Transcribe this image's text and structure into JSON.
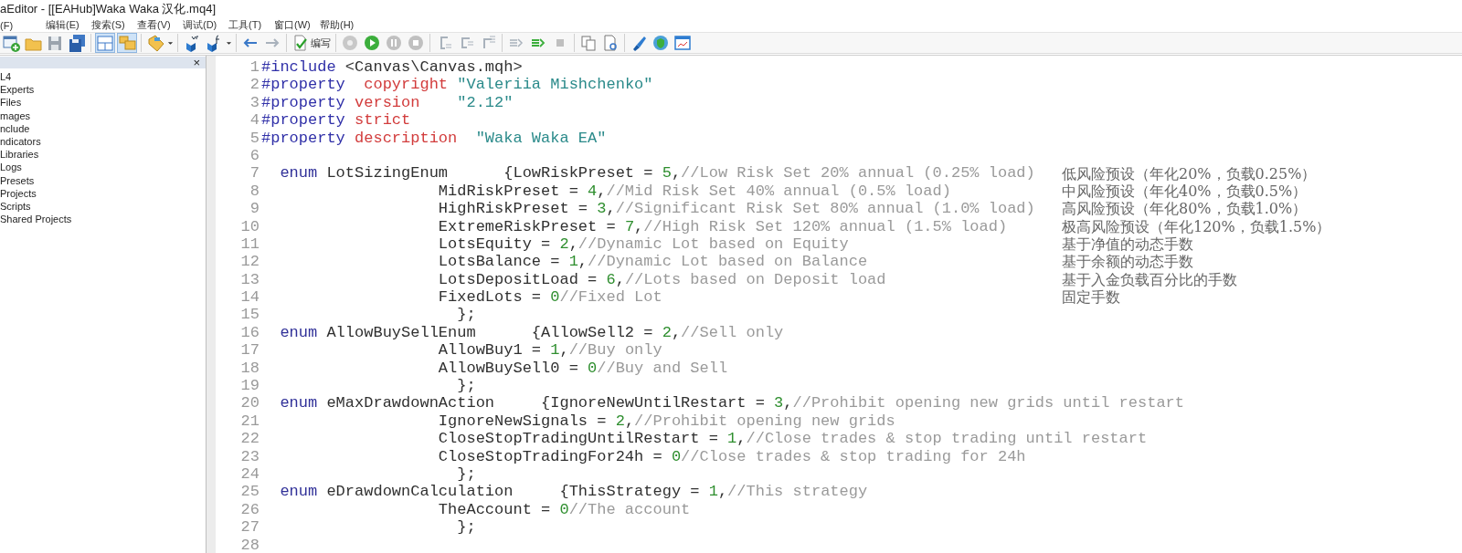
{
  "window": {
    "title": "aEditor - [[EAHub]Waka Waka 汉化.mq4]"
  },
  "menu": [
    "(F)",
    "编辑(E)",
    "搜索(S)",
    "查看(V)",
    "调试(D)",
    "工具(T)",
    "窗口(W)",
    "帮助(H)"
  ],
  "toolbar": {
    "compile_label": "编写"
  },
  "navigator": {
    "close": "×",
    "items": [
      "L4",
      "Experts",
      "Files",
      "mages",
      "nclude",
      "ndicators",
      "Libraries",
      "Logs",
      "Presets",
      "Projects",
      "Scripts",
      "Shared Projects"
    ]
  },
  "editor": {
    "lines": [
      {
        "number": "1",
        "tokens": [
          {
            "kind": "preprocessor",
            "text": "#include"
          },
          {
            "kind": "plain",
            "text": " <Canvas\\Canvas.mqh>"
          }
        ]
      },
      {
        "number": "2",
        "tokens": [
          {
            "kind": "preprocessor",
            "text": "#property"
          },
          {
            "kind": "property",
            "text": "  copyright"
          },
          {
            "kind": "string",
            "text": " \"Valeriia Mishchenko\""
          }
        ]
      },
      {
        "number": "3",
        "tokens": [
          {
            "kind": "preprocessor",
            "text": "#property"
          },
          {
            "kind": "property",
            "text": " version"
          },
          {
            "kind": "string",
            "text": "    \"2.12\""
          }
        ]
      },
      {
        "number": "4",
        "tokens": [
          {
            "kind": "preprocessor",
            "text": "#property"
          },
          {
            "kind": "property",
            "text": " strict"
          }
        ]
      },
      {
        "number": "5",
        "tokens": [
          {
            "kind": "preprocessor",
            "text": "#property"
          },
          {
            "kind": "property",
            "text": " description"
          },
          {
            "kind": "string",
            "text": "  \"Waka Waka EA\""
          }
        ]
      },
      {
        "number": "6"
      },
      {
        "number": "7",
        "tokens": [
          {
            "kind": "keyword",
            "text": "  enum"
          },
          {
            "kind": "plain",
            "text": " LotSizingEnum      {LowRiskPreset = "
          },
          {
            "kind": "number",
            "text": "5"
          },
          {
            "kind": "plain",
            "text": ","
          },
          {
            "kind": "comment",
            "text": "//Low Risk Set 20% annual (0.25% load)"
          }
        ],
        "note": "低风险预设（年化20%，负载0.25%）"
      },
      {
        "number": "8",
        "tokens": [
          {
            "kind": "plain",
            "text": "                   MidRiskPreset = "
          },
          {
            "kind": "number",
            "text": "4"
          },
          {
            "kind": "plain",
            "text": ","
          },
          {
            "kind": "comment",
            "text": "//Mid Risk Set 40% annual (0.5% load)"
          }
        ],
        "note": "中风险预设（年化40%，负载0.5%）"
      },
      {
        "number": "9",
        "tokens": [
          {
            "kind": "plain",
            "text": "                   HighRiskPreset = "
          },
          {
            "kind": "number",
            "text": "3"
          },
          {
            "kind": "plain",
            "text": ","
          },
          {
            "kind": "comment",
            "text": "//Significant Risk Set 80% annual (1.0% load)"
          }
        ],
        "note": "高风险预设（年化80%，负载1.0%）"
      },
      {
        "number": "10",
        "tokens": [
          {
            "kind": "plain",
            "text": "                   ExtremeRiskPreset = "
          },
          {
            "kind": "number",
            "text": "7"
          },
          {
            "kind": "plain",
            "text": ","
          },
          {
            "kind": "comment",
            "text": "//High Risk Set 120% annual (1.5% load)"
          }
        ],
        "note": "极高风险预设（年化120%，负载1.5%）"
      },
      {
        "number": "11",
        "tokens": [
          {
            "kind": "plain",
            "text": "                   LotsEquity = "
          },
          {
            "kind": "number",
            "text": "2"
          },
          {
            "kind": "plain",
            "text": ","
          },
          {
            "kind": "comment",
            "text": "//Dynamic Lot based on Equity"
          }
        ],
        "note": "基于净值的动态手数"
      },
      {
        "number": "12",
        "tokens": [
          {
            "kind": "plain",
            "text": "                   LotsBalance = "
          },
          {
            "kind": "number",
            "text": "1"
          },
          {
            "kind": "plain",
            "text": ","
          },
          {
            "kind": "comment",
            "text": "//Dynamic Lot based on Balance"
          }
        ],
        "note": "基于余额的动态手数"
      },
      {
        "number": "13",
        "tokens": [
          {
            "kind": "plain",
            "text": "                   LotsDepositLoad = "
          },
          {
            "kind": "number",
            "text": "6"
          },
          {
            "kind": "plain",
            "text": ","
          },
          {
            "kind": "comment",
            "text": "//Lots based on Deposit load"
          }
        ],
        "note": "基于入金负载百分比的手数"
      },
      {
        "number": "14",
        "tokens": [
          {
            "kind": "plain",
            "text": "                   FixedLots = "
          },
          {
            "kind": "number",
            "text": "0"
          },
          {
            "kind": "comment",
            "text": "//Fixed Lot"
          }
        ],
        "note": "固定手数"
      },
      {
        "number": "15",
        "tokens": [
          {
            "kind": "plain",
            "text": "                     };"
          }
        ]
      },
      {
        "number": "16",
        "tokens": [
          {
            "kind": "keyword",
            "text": "  enum"
          },
          {
            "kind": "plain",
            "text": " AllowBuySellEnum      {AllowSell2 = "
          },
          {
            "kind": "number",
            "text": "2"
          },
          {
            "kind": "plain",
            "text": ","
          },
          {
            "kind": "comment",
            "text": "//Sell only"
          }
        ]
      },
      {
        "number": "17",
        "tokens": [
          {
            "kind": "plain",
            "text": "                   AllowBuy1 = "
          },
          {
            "kind": "number",
            "text": "1"
          },
          {
            "kind": "plain",
            "text": ","
          },
          {
            "kind": "comment",
            "text": "//Buy only"
          }
        ]
      },
      {
        "number": "18",
        "tokens": [
          {
            "kind": "plain",
            "text": "                   AllowBuySell0 = "
          },
          {
            "kind": "number",
            "text": "0"
          },
          {
            "kind": "comment",
            "text": "//Buy and Sell"
          }
        ]
      },
      {
        "number": "19",
        "tokens": [
          {
            "kind": "plain",
            "text": "                     };"
          }
        ]
      },
      {
        "number": "20",
        "tokens": [
          {
            "kind": "keyword",
            "text": "  enum"
          },
          {
            "kind": "plain",
            "text": " eMaxDrawdownAction     {IgnoreNewUntilRestart = "
          },
          {
            "kind": "number",
            "text": "3"
          },
          {
            "kind": "plain",
            "text": ","
          },
          {
            "kind": "comment",
            "text": "//Prohibit opening new grids until restart"
          }
        ]
      },
      {
        "number": "21",
        "tokens": [
          {
            "kind": "plain",
            "text": "                   IgnoreNewSignals = "
          },
          {
            "kind": "number",
            "text": "2"
          },
          {
            "kind": "plain",
            "text": ","
          },
          {
            "kind": "comment",
            "text": "//Prohibit opening new grids"
          }
        ]
      },
      {
        "number": "22",
        "tokens": [
          {
            "kind": "plain",
            "text": "                   CloseStopTradingUntilRestart = "
          },
          {
            "kind": "number",
            "text": "1"
          },
          {
            "kind": "plain",
            "text": ","
          },
          {
            "kind": "comment",
            "text": "//Close trades & stop trading until restart"
          }
        ]
      },
      {
        "number": "23",
        "tokens": [
          {
            "kind": "plain",
            "text": "                   CloseStopTradingFor24h = "
          },
          {
            "kind": "number",
            "text": "0"
          },
          {
            "kind": "comment",
            "text": "//Close trades & stop trading for 24h"
          }
        ]
      },
      {
        "number": "24",
        "tokens": [
          {
            "kind": "plain",
            "text": "                     };"
          }
        ]
      },
      {
        "number": "25",
        "tokens": [
          {
            "kind": "keyword",
            "text": "  enum"
          },
          {
            "kind": "plain",
            "text": " eDrawdownCalculation     {ThisStrategy = "
          },
          {
            "kind": "number",
            "text": "1"
          },
          {
            "kind": "plain",
            "text": ","
          },
          {
            "kind": "comment",
            "text": "//This strategy"
          }
        ]
      },
      {
        "number": "26",
        "tokens": [
          {
            "kind": "plain",
            "text": "                   TheAccount = "
          },
          {
            "kind": "number",
            "text": "0"
          },
          {
            "kind": "comment",
            "text": "//The account"
          }
        ]
      },
      {
        "number": "27",
        "tokens": [
          {
            "kind": "plain",
            "text": "                     };"
          }
        ]
      },
      {
        "number": "28"
      }
    ]
  }
}
